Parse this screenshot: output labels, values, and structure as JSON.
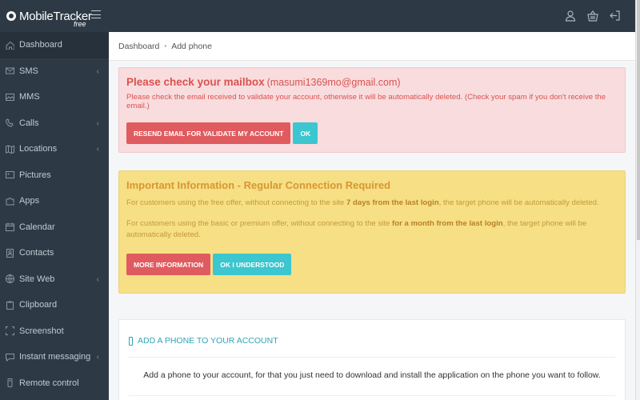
{
  "brand": {
    "name": "MobileTracker",
    "sub": "free"
  },
  "breadcrumb": {
    "home": "Dashboard",
    "current": "Add phone"
  },
  "sidebar": {
    "items": [
      {
        "label": "Dashboard",
        "icon": "home-icon",
        "caret": false
      },
      {
        "label": "SMS",
        "icon": "mail-icon",
        "caret": true
      },
      {
        "label": "MMS",
        "icon": "image-icon",
        "caret": false
      },
      {
        "label": "Calls",
        "icon": "phone-icon",
        "caret": true
      },
      {
        "label": "Locations",
        "icon": "map-icon",
        "caret": true
      },
      {
        "label": "Pictures",
        "icon": "picture-icon",
        "caret": false
      },
      {
        "label": "Apps",
        "icon": "puzzle-icon",
        "caret": false
      },
      {
        "label": "Calendar",
        "icon": "calendar-icon",
        "caret": false
      },
      {
        "label": "Contacts",
        "icon": "contacts-icon",
        "caret": false
      },
      {
        "label": "Site Web",
        "icon": "globe-icon",
        "caret": true
      },
      {
        "label": "Clipboard",
        "icon": "clipboard-icon",
        "caret": false
      },
      {
        "label": "Screenshot",
        "icon": "screenshot-icon",
        "caret": false
      },
      {
        "label": "Instant messaging",
        "icon": "chat-icon",
        "caret": true
      },
      {
        "label": "Remote control",
        "icon": "remote-icon",
        "caret": false
      }
    ]
  },
  "mailbox_alert": {
    "title": "Please check your mailbox",
    "email": "(masumi1369mo@gmail.com)",
    "text": "Please check the email received to validate your account, otherwise it will be automatically deleted. (Check your spam if you don't receive the email.)",
    "resend_button": "RESEND EMAIL FOR VALIDATE MY ACCOUNT",
    "ok_button": "OK"
  },
  "info_alert": {
    "title": "Important Information - Regular Connection Required",
    "p1_before": "For customers using the free offer, without connecting to the site ",
    "p1_bold": "7 days from the last login",
    "p1_after": ", the target phone will be automatically deleted.",
    "p2_before": "For customers using the basic or premium offer, without connecting to the site ",
    "p2_bold": "for a month from the last login",
    "p2_after": ", the target phone will be automatically deleted.",
    "more_button": "MORE INFORMATION",
    "understood_button": "OK I UNDERSTOOD"
  },
  "add_phone": {
    "header": "ADD A PHONE TO YOUR ACCOUNT",
    "text": "Add a phone to your account, for that you just need to download and install the application on the phone you want to follow."
  },
  "colors": {
    "sidebar_bg": "#2d3a46",
    "danger": "#d9534f",
    "danger_bg": "#f9dcde",
    "warning_bg": "#f6df84",
    "teal": "#3cc6cf",
    "red_button": "#e05b5f"
  }
}
